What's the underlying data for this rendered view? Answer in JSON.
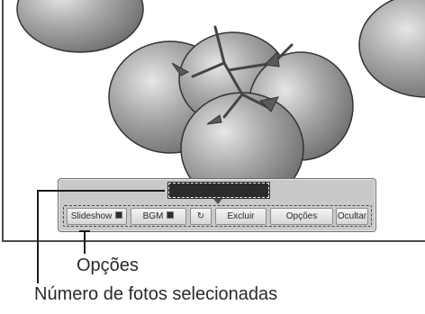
{
  "toolbar": {
    "selected_count": "",
    "buttons": {
      "slideshow": "Slideshow",
      "bgm": "BGM",
      "rotate": "↻",
      "delete": "Excluir",
      "options": "Opções",
      "hide": "Ocultar"
    }
  },
  "callouts": {
    "options": "Opções",
    "selected_count": "Número de fotos selecionadas"
  }
}
